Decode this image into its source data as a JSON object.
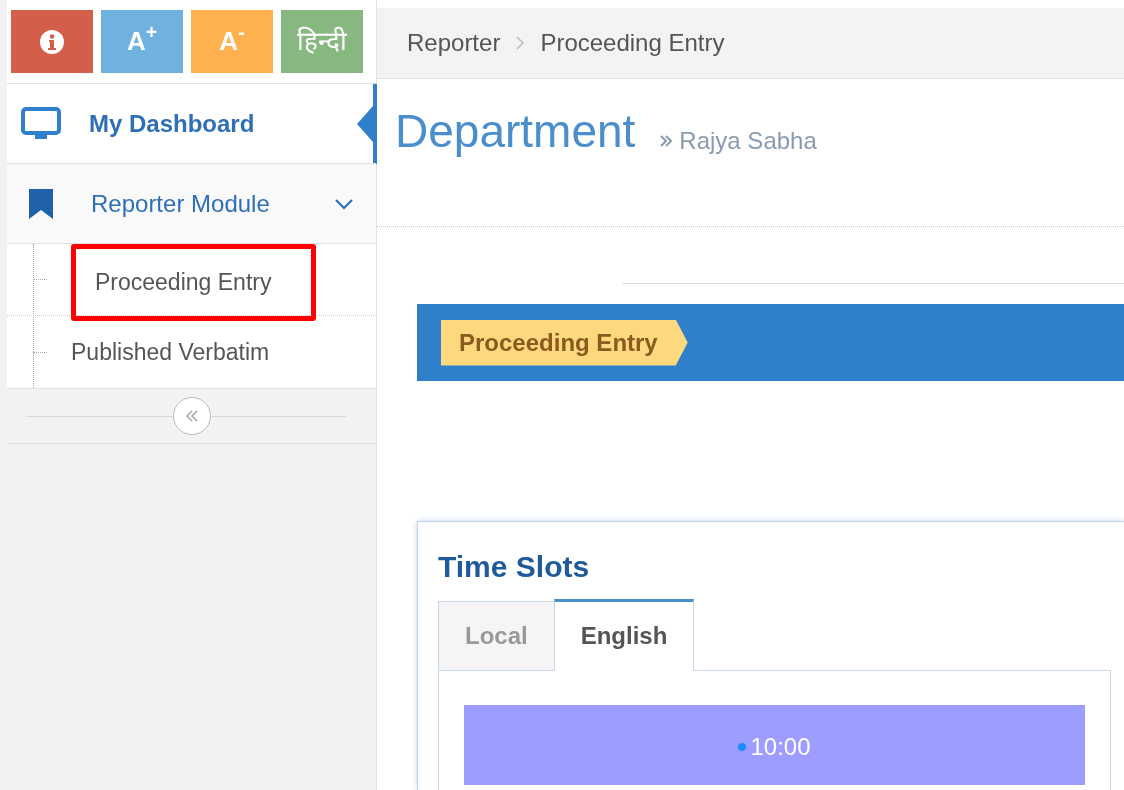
{
  "toolbar": [
    {
      "kind": "info",
      "color": "#d35f4a"
    },
    {
      "kind": "text",
      "label": "A$^{+}$",
      "color": "#6fb2e0"
    },
    {
      "kind": "text",
      "label": "A$^{-}$",
      "color": "#feb14e"
    },
    {
      "kind": "text",
      "label": "हिन्दी",
      "color": "#87b87f"
    }
  ],
  "sidebar": {
    "items": [
      {
        "kind": "dashboard",
        "label": "My Dashboard",
        "selected": true
      },
      {
        "kind": "module",
        "label": "Reporter Module",
        "expanded": true,
        "selected": false,
        "children": [
          {
            "label": "Proceeding Entry",
            "highlighted": true
          },
          {
            "label": "Published Verbatim",
            "highlighted": false
          }
        ]
      }
    ]
  },
  "breadcrumb": [
    "Reporter",
    "Proceeding Entry"
  ],
  "page_header": {
    "title": "Department",
    "subtitle": "Rajya Sabha"
  },
  "banner": {
    "tag": "Proceeding Entry"
  },
  "card": {
    "title": "Time Slots",
    "tabs": [
      {
        "label": "Local",
        "selected": false
      },
      {
        "label": "English",
        "selected": true
      }
    ],
    "slots": [
      {
        "time": "10:00"
      }
    ]
  }
}
